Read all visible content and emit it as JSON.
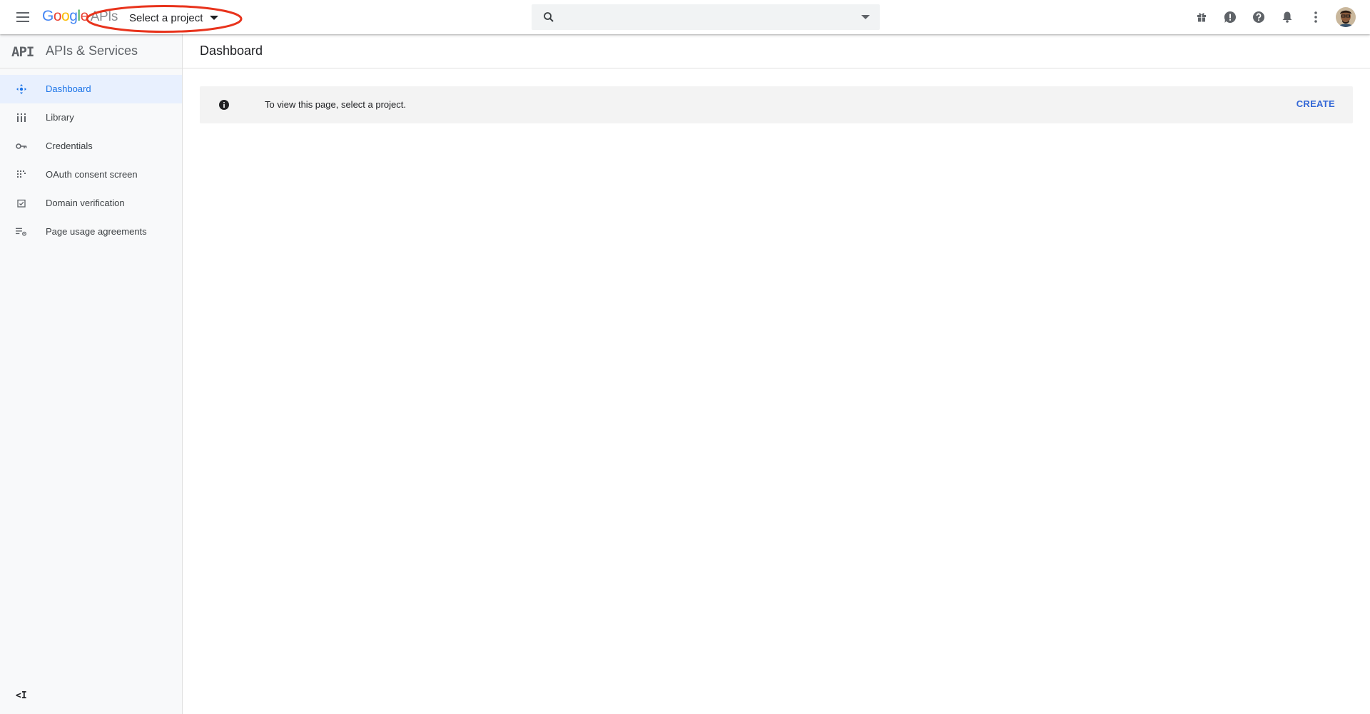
{
  "topbar": {
    "logo": {
      "g1": "G",
      "o1": "o",
      "o2": "o",
      "g2": "g",
      "l": "l",
      "e": "e",
      "apis": "APIs"
    },
    "project_picker_label": "Select a project",
    "search": {
      "value": "",
      "placeholder": ""
    },
    "icons": [
      "menu-icon",
      "search-icon",
      "gift-icon",
      "feedback-icon",
      "help-icon",
      "notifications-icon",
      "more-vert-icon"
    ]
  },
  "sidebar": {
    "mark": "API",
    "title": "APIs & Services",
    "items": [
      {
        "label": "Dashboard",
        "icon": "dashboard-icon",
        "active": true
      },
      {
        "label": "Library",
        "icon": "library-icon",
        "active": false
      },
      {
        "label": "Credentials",
        "icon": "key-icon",
        "active": false
      },
      {
        "label": "OAuth consent screen",
        "icon": "consent-grid-icon",
        "active": false
      },
      {
        "label": "Domain verification",
        "icon": "checkbox-icon",
        "active": false
      },
      {
        "label": "Page usage agreements",
        "icon": "list-settings-icon",
        "active": false
      }
    ],
    "collapse_label": "<I"
  },
  "main": {
    "title": "Dashboard",
    "banner": {
      "text": "To view this page, select a project.",
      "action": "CREATE"
    }
  },
  "colors": {
    "accent": "#1a73e8",
    "active_bg": "#e8f0fe",
    "create": "#3367d6",
    "annotation": "#e8331c"
  }
}
